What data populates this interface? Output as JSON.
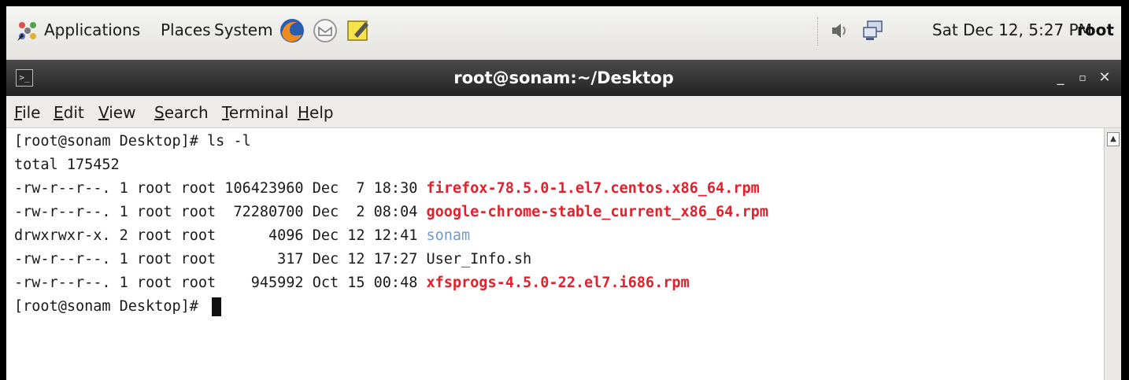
{
  "panel": {
    "menu": [
      "Applications",
      "Places",
      "System"
    ],
    "clock": "Sat Dec 12,  5:27 PM",
    "user": "root"
  },
  "window": {
    "title": "root@sonam:~/Desktop"
  },
  "menubar": [
    "File",
    "Edit",
    "View",
    "Search",
    "Terminal",
    "Help"
  ],
  "terminal": {
    "prompt": "[root@sonam Desktop]# ",
    "command": "ls -l",
    "total": "total 175452",
    "entries": [
      {
        "meta": "-rw-r--r--. 1 root root 106423960 Dec  7 18:30 ",
        "name": "firefox-78.5.0-1.el7.centos.x86_64.rpm",
        "color": "#e4202a"
      },
      {
        "meta": "-rw-r--r--. 1 root root  72280700 Dec  2 08:04 ",
        "name": "google-chrome-stable_current_x86_64.rpm",
        "color": "#e4202a"
      },
      {
        "meta": "drwxrwxr-x. 2 root root      4096 Dec 12 12:41 ",
        "name": "sonam",
        "color": "#6f9ad0"
      },
      {
        "meta": "-rw-r--r--. 1 root root       317 Dec 12 17:27 ",
        "name": "User_Info.sh",
        "color": "#1a1a1a"
      },
      {
        "meta": "-rw-r--r--. 1 root root    945992 Oct 15 00:48 ",
        "name": "xfsprogs-4.5.0-22.el7.i686.rpm",
        "color": "#e4202a"
      }
    ],
    "final_prompt": "[root@sonam Desktop]# "
  },
  "icons": {
    "apps": "applications-icon",
    "firefox": "firefox-icon",
    "mail": "mail-icon",
    "notes": "notes-icon",
    "volume": "volume-icon",
    "network": "network-icon",
    "terminal": "terminal-icon"
  }
}
